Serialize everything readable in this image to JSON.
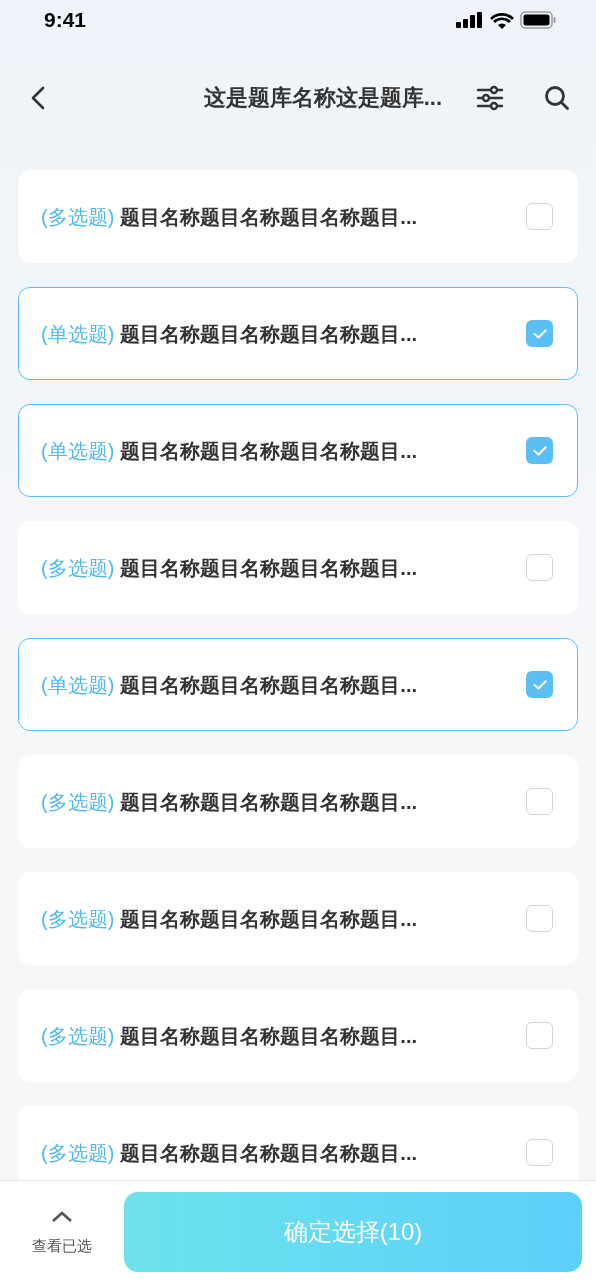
{
  "status_bar": {
    "time": "9:41"
  },
  "nav": {
    "title": "这是题库名称这是题库..."
  },
  "questions": [
    {
      "type": "(多选题)",
      "title": "题目名称题目名称题目名称题目...",
      "selected": false
    },
    {
      "type": "(单选题)",
      "title": "题目名称题目名称题目名称题目...",
      "selected": true
    },
    {
      "type": "(单选题)",
      "title": "题目名称题目名称题目名称题目...",
      "selected": true
    },
    {
      "type": "(多选题)",
      "title": "题目名称题目名称题目名称题目...",
      "selected": false
    },
    {
      "type": "(单选题)",
      "title": "题目名称题目名称题目名称题目...",
      "selected": true
    },
    {
      "type": "(多选题)",
      "title": "题目名称题目名称题目名称题目...",
      "selected": false
    },
    {
      "type": "(多选题)",
      "title": "题目名称题目名称题目名称题目...",
      "selected": false
    },
    {
      "type": "(多选题)",
      "title": "题目名称题目名称题目名称题目...",
      "selected": false
    },
    {
      "type": "(多选题)",
      "title": "题目名称题目名称题目名称题目...",
      "selected": false
    }
  ],
  "footer": {
    "view_selected": "查看已选",
    "confirm": "确定选择(10)"
  }
}
